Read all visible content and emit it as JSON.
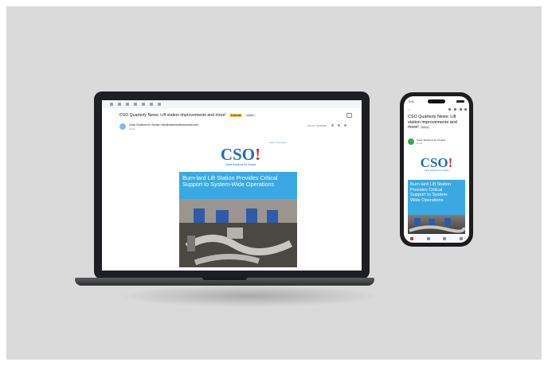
{
  "laptop": {
    "email": {
      "subject": "CSO Quarterly News: Lift station improvements and more!",
      "label_external": "External",
      "label_inbox": "Inbox",
      "sender": "Clean Solutions for Omaha <info@cleansolutionsomaha.com>",
      "to": "to me",
      "date": "Feb 27, 10:00 AM",
      "browser_link": "View in browser",
      "logo_text": "CSO",
      "logo_mark": "!",
      "logo_tagline": "Clean Solutions for Omaha",
      "headline": "Burn-lard Lift Station Provides Critical Support to System-Wide Operations"
    }
  },
  "phone": {
    "time": "9:41",
    "back": "←",
    "subject": "CSO Quarterly News: Lift station improvements and more!",
    "label_inbox": "Inbox",
    "sender": "Clean Solutions for Omaha",
    "to": "to me",
    "logo_text": "CSO",
    "logo_mark": "!",
    "logo_tagline": "Clean Solutions for Omaha",
    "headline": "Burn-lard Lift Station Provides Critical Support to System-Wide Operations"
  },
  "colors": {
    "brand_blue": "#1f6fb3",
    "brand_red": "#d9262b",
    "banner_blue": "#3aa9e3",
    "backdrop": "#dadada"
  }
}
